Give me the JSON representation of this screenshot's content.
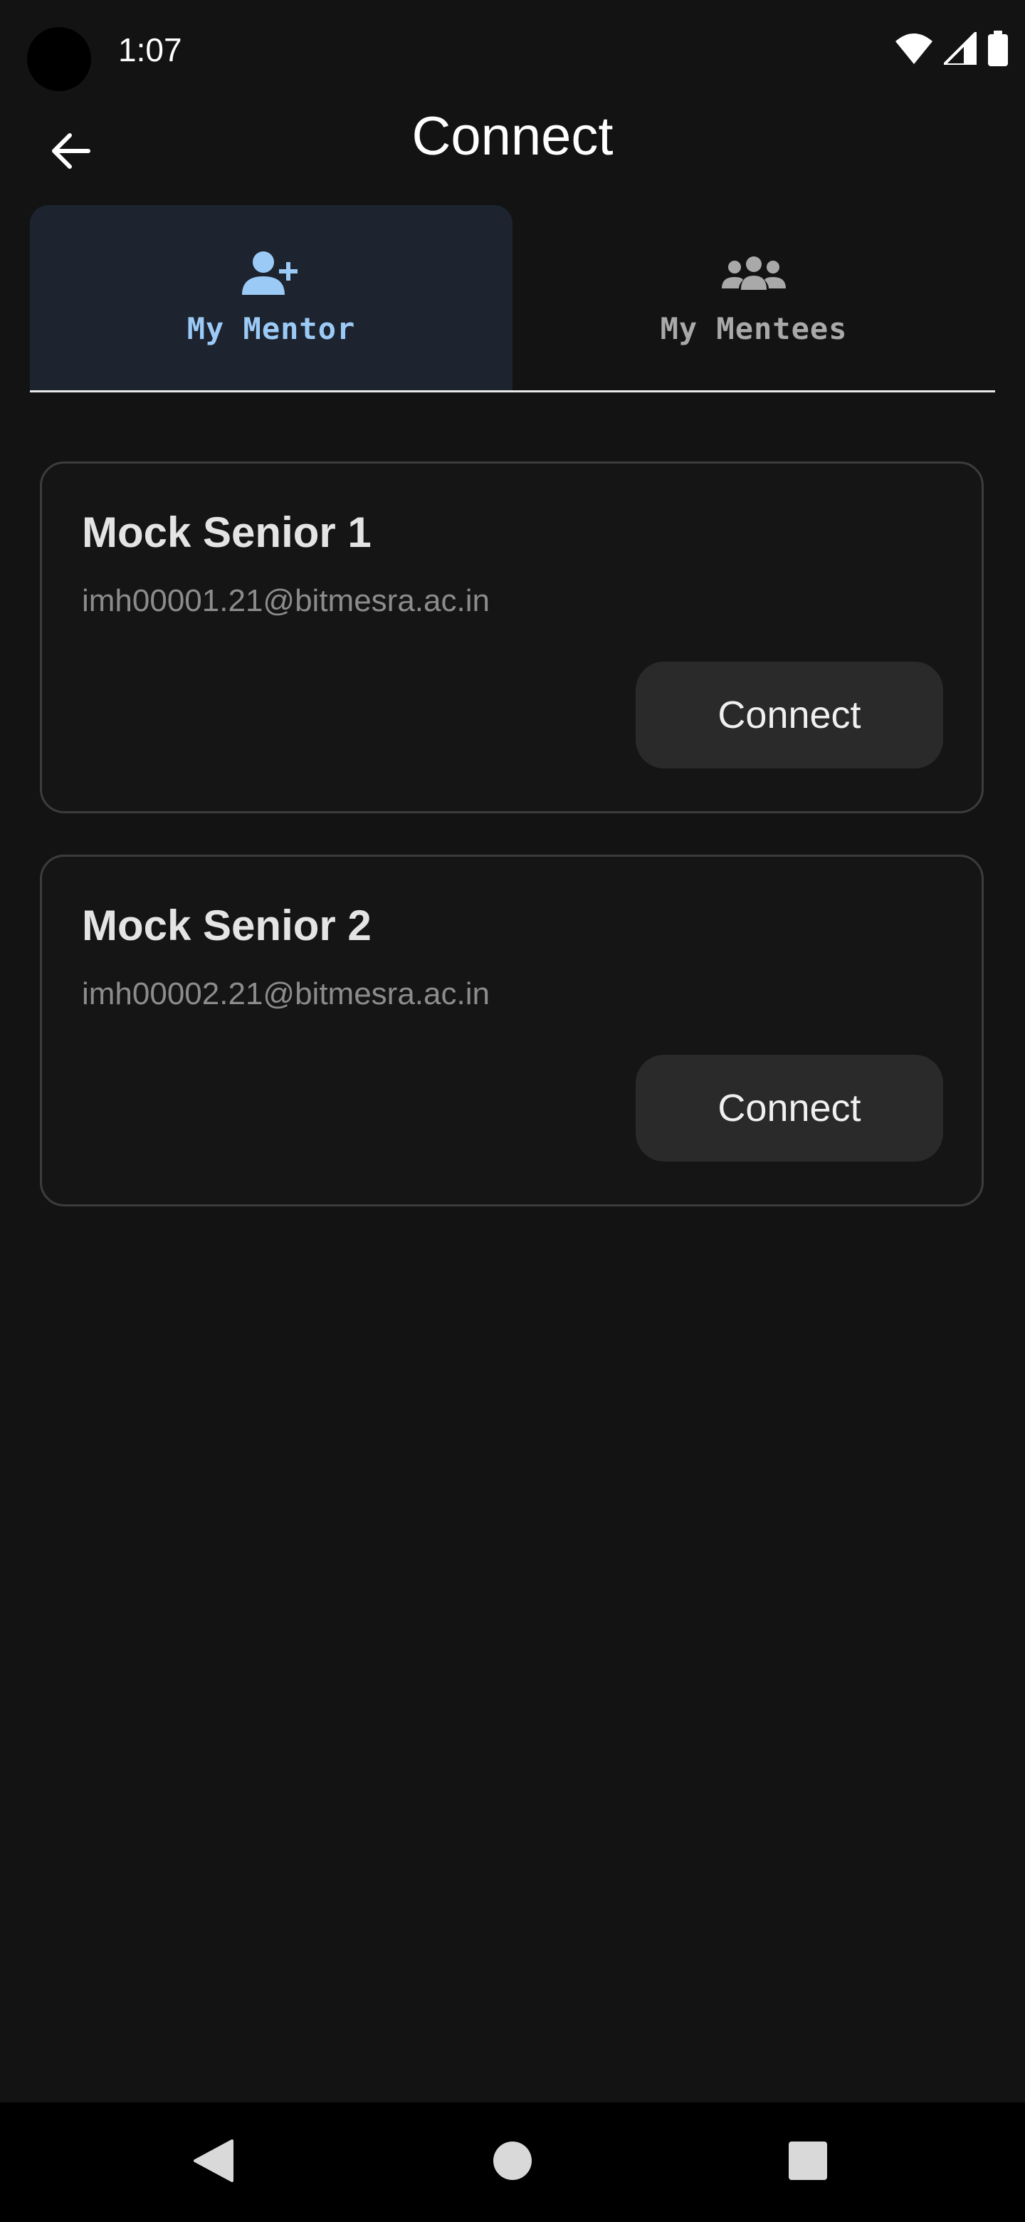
{
  "status_bar": {
    "time": "1:07",
    "icons": [
      "wifi-icon",
      "cellular-signal-icon",
      "battery-icon"
    ]
  },
  "app_bar": {
    "title": "Connect",
    "back_icon": "arrow-left-icon"
  },
  "tabs": [
    {
      "label": "My Mentor",
      "icon": "person-add-icon",
      "active": true
    },
    {
      "label": "My Mentees",
      "icon": "group-icon",
      "active": false
    }
  ],
  "cards": [
    {
      "name": "Mock Senior 1",
      "email": "imh00001.21@bitmesra.ac.in",
      "button_label": "Connect"
    },
    {
      "name": "Mock Senior 2",
      "email": "imh00002.21@bitmesra.ac.in",
      "button_label": "Connect"
    }
  ],
  "navigation_bar": {
    "buttons": [
      "back-triangle-icon",
      "home-circle-icon",
      "recents-square-icon"
    ]
  },
  "colors": {
    "background": "#131313",
    "active_tab_bg": "#1d2430",
    "active_tab_accent": "#9ccaf6",
    "inactive_tab_text": "#a9a9a9",
    "card_border": "#3c3c3c",
    "button_bg": "#2a2a2a",
    "email_text": "#8c8c8c"
  }
}
